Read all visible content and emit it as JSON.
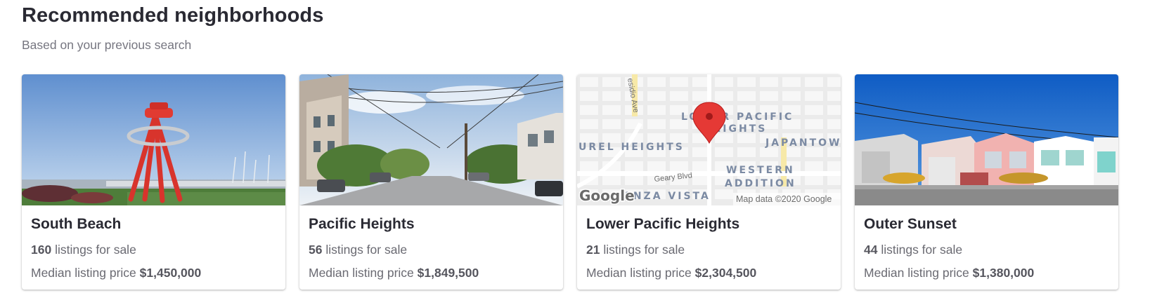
{
  "header": {
    "title": "Recommended neighborhoods",
    "subtitle": "Based on your previous search"
  },
  "cards": [
    {
      "name": "South Beach",
      "listings_count": "160",
      "listings_suffix": " listings for sale",
      "price_prefix": "Median listing price ",
      "price": "$1,450,000"
    },
    {
      "name": "Pacific Heights",
      "listings_count": "56",
      "listings_suffix": " listings for sale",
      "price_prefix": "Median listing price ",
      "price": "$1,849,500"
    },
    {
      "name": "Lower Pacific Heights",
      "listings_count": "21",
      "listings_suffix": " listings for sale",
      "price_prefix": "Median listing price ",
      "price": "$2,304,500",
      "map": {
        "labels": [
          "LOWER PACIFIC",
          "HEIGHTS",
          "UREL HEIGHTS",
          "JAPANTOW",
          "WESTERN",
          "ADDITION",
          "ANZA VISTA"
        ],
        "streets": [
          "esidio Ave",
          "Geary Blvd"
        ],
        "logo": "Google",
        "attribution": "Map data ©2020 Google"
      }
    },
    {
      "name": "Outer Sunset",
      "listings_count": "44",
      "listings_suffix": " listings for sale",
      "price_prefix": "Median listing price ",
      "price": "$1,380,000"
    }
  ],
  "colors": {
    "title": "#2a2a33",
    "muted": "#767680",
    "map_pin": "#e53935"
  }
}
